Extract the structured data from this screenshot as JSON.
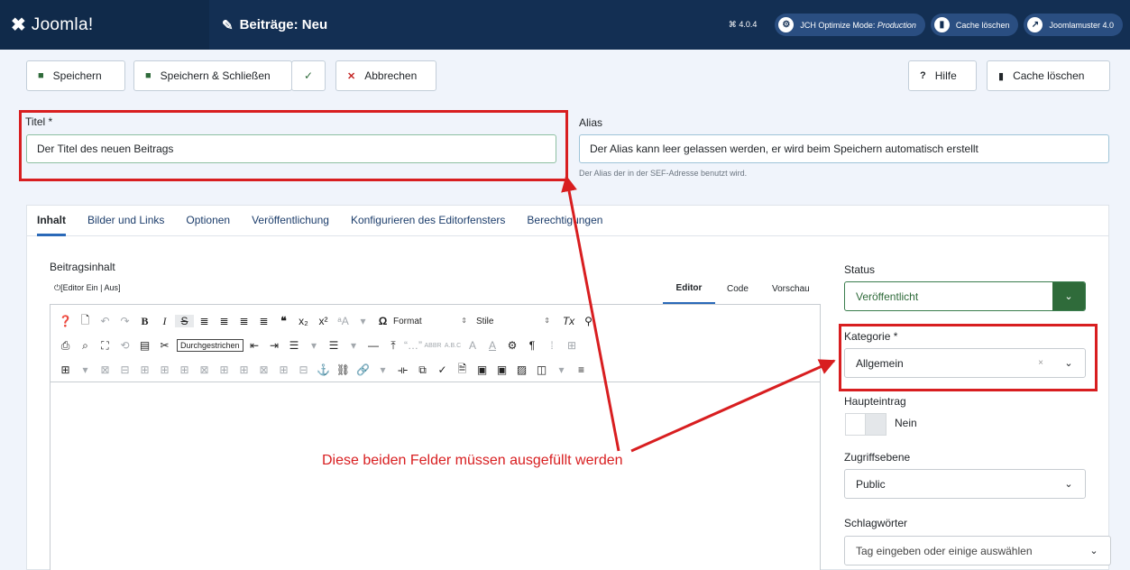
{
  "header": {
    "logo_text": "Joomla!",
    "page_title": "Beiträge: Neu",
    "version": "4.0.4",
    "jch_label": "JCH Optimize Mode:",
    "jch_mode": "Production",
    "cache_clear": "Cache löschen",
    "site_link": "Joomlamuster 4.0"
  },
  "toolbar": {
    "save": "Speichern",
    "save_close": "Speichern & Schließen",
    "cancel": "Abbrechen",
    "help": "Hilfe",
    "cache_clear": "Cache löschen"
  },
  "form": {
    "title_label": "Titel *",
    "title_value": "Der Titel des neuen Beitrags",
    "alias_label": "Alias",
    "alias_value": "Der Alias kann leer gelassen werden, er wird beim Speichern automatisch erstellt",
    "alias_hint": "Der Alias der in der SEF-Adresse benutzt wird."
  },
  "tabs": [
    {
      "label": "Inhalt"
    },
    {
      "label": "Bilder und Links"
    },
    {
      "label": "Optionen"
    },
    {
      "label": "Veröffentlichung"
    },
    {
      "label": "Konfigurieren des Editorfensters"
    },
    {
      "label": "Berechtigungen"
    }
  ],
  "editor": {
    "label": "Beitragsinhalt",
    "toggle": "[Editor Ein | Aus]",
    "tab_editor": "Editor",
    "tab_code": "Code",
    "tab_preview": "Vorschau",
    "format_select": "Format",
    "styles_select": "Stile",
    "tooltip": "Durchgestrichen"
  },
  "sidebar": {
    "status_label": "Status",
    "status_value": "Veröffentlicht",
    "category_label": "Kategorie *",
    "category_value": "Allgemein",
    "featured_label": "Haupteintrag",
    "featured_value": "Nein",
    "access_label": "Zugriffsebene",
    "access_value": "Public",
    "tags_label": "Schlagwörter",
    "tags_placeholder": "Tag eingeben oder einige auswählen"
  },
  "annotation": {
    "text": "Diese beiden Felder müssen ausgefüllt werden"
  },
  "colors": {
    "header_bg": "#132f53",
    "annotation_red": "#d81e20",
    "status_green": "#2f6b3a"
  }
}
